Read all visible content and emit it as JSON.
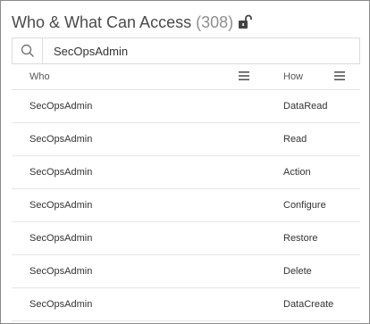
{
  "panel": {
    "title": "Who & What Can Access",
    "count": "(308)",
    "lock_icon": "unlocked-padlock-icon"
  },
  "search": {
    "icon": "search-icon",
    "value": "SecOpsAdmin",
    "placeholder": ""
  },
  "table": {
    "columns": [
      {
        "label": "Who",
        "menu_icon": "hamburger-menu-icon"
      },
      {
        "label": "How",
        "menu_icon": "hamburger-menu-icon"
      }
    ],
    "rows": [
      {
        "who": "SecOpsAdmin",
        "how": "DataRead"
      },
      {
        "who": "SecOpsAdmin",
        "how": "Read"
      },
      {
        "who": "SecOpsAdmin",
        "how": "Action"
      },
      {
        "who": "SecOpsAdmin",
        "how": "Configure"
      },
      {
        "who": "SecOpsAdmin",
        "how": "Restore"
      },
      {
        "who": "SecOpsAdmin",
        "how": "Delete"
      },
      {
        "who": "SecOpsAdmin",
        "how": "DataCreate"
      }
    ]
  },
  "colors": {
    "border": "#8a8a8a",
    "title_text": "#4a4a4a",
    "count_text": "#8e8e8e",
    "divider": "#e6e6e6"
  }
}
